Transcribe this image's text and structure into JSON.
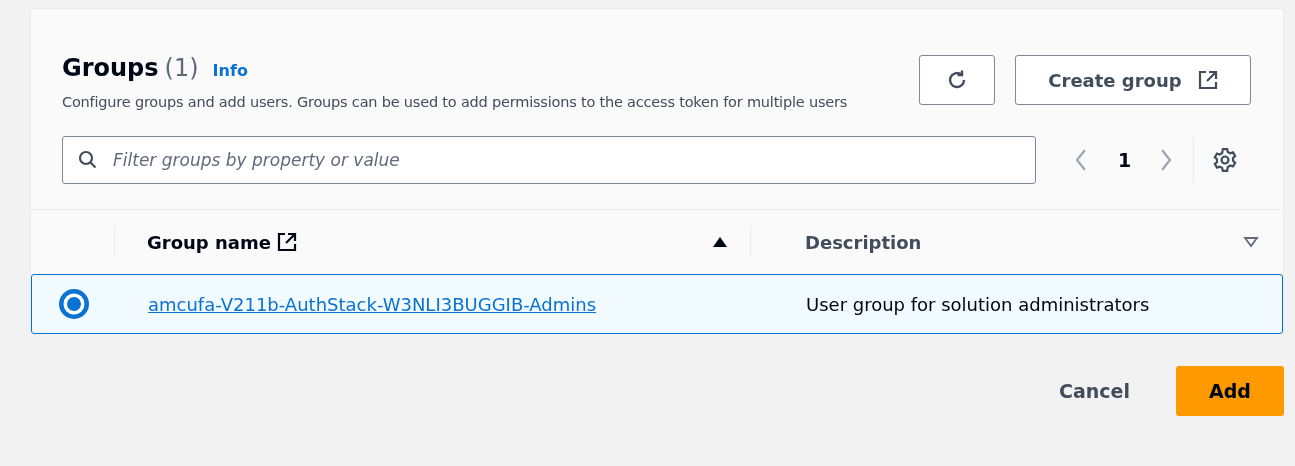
{
  "header": {
    "title": "Groups",
    "count": "(1)",
    "info_link": "Info",
    "description": "Configure groups and add users. Groups can be used to add permissions to the access token for multiple users",
    "create_button": "Create group"
  },
  "filter": {
    "placeholder": "Filter groups by property or value"
  },
  "pagination": {
    "current_page": "1"
  },
  "table": {
    "columns": [
      {
        "label": "Group name",
        "external_link": true,
        "sorted": true
      },
      {
        "label": "Description",
        "external_link": false,
        "sorted": false
      }
    ],
    "rows": [
      {
        "selected": true,
        "group_name": "amcufa-V211b-AuthStack-W3NLI3BUGGIB-Admins",
        "description": "User group for solution administrators"
      }
    ]
  },
  "footer": {
    "cancel_button": "Cancel",
    "add_button": "Add"
  }
}
